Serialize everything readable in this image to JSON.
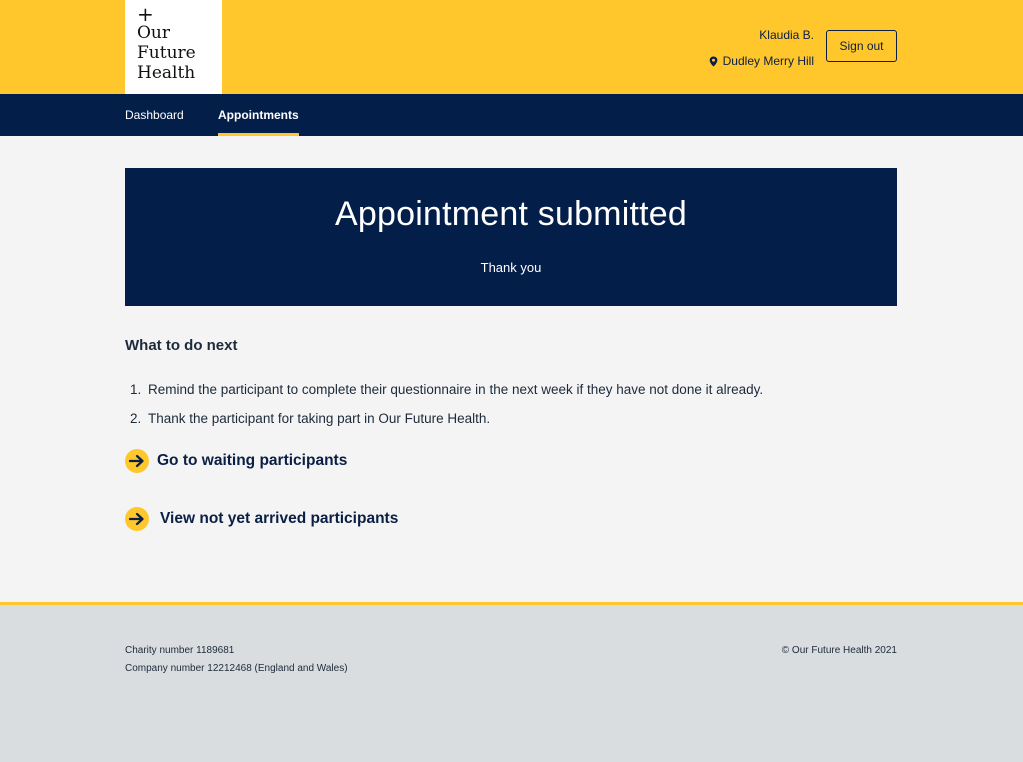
{
  "header": {
    "logo": {
      "symbol": "+",
      "line1": "Our",
      "line2": "Future",
      "line3": "Health"
    },
    "user_name": "Klaudia B.",
    "location": "Dudley Merry Hill",
    "location_icon": "map-pin-icon",
    "sign_out_label": "Sign out"
  },
  "nav": {
    "items": [
      {
        "label": "Dashboard",
        "active": false
      },
      {
        "label": "Appointments",
        "active": true
      }
    ]
  },
  "banner": {
    "title": "Appointment submitted",
    "subtitle": "Thank you"
  },
  "next_steps": {
    "heading": "What to do next",
    "items": [
      {
        "number": "1.",
        "text": "Remind the participant to complete their questionnaire in the next week if they have not done it already."
      },
      {
        "number": "2.",
        "text": "Thank the participant for taking part in Our Future Health."
      }
    ]
  },
  "links": [
    {
      "label": "Go to waiting participants",
      "icon": "arrow-right-icon"
    },
    {
      "label": "View not yet arrived participants",
      "icon": "arrow-right-icon"
    }
  ],
  "footer": {
    "charity": "Charity number 1189681",
    "company": "Company number 12212468 (England and Wales)",
    "copyright": "© Our Future Health 2021"
  },
  "colors": {
    "brand_yellow": "#ffc72c",
    "navy": "#041e4a",
    "page_bg": "#f4f4f4",
    "footer_bg": "#d9dde0"
  }
}
